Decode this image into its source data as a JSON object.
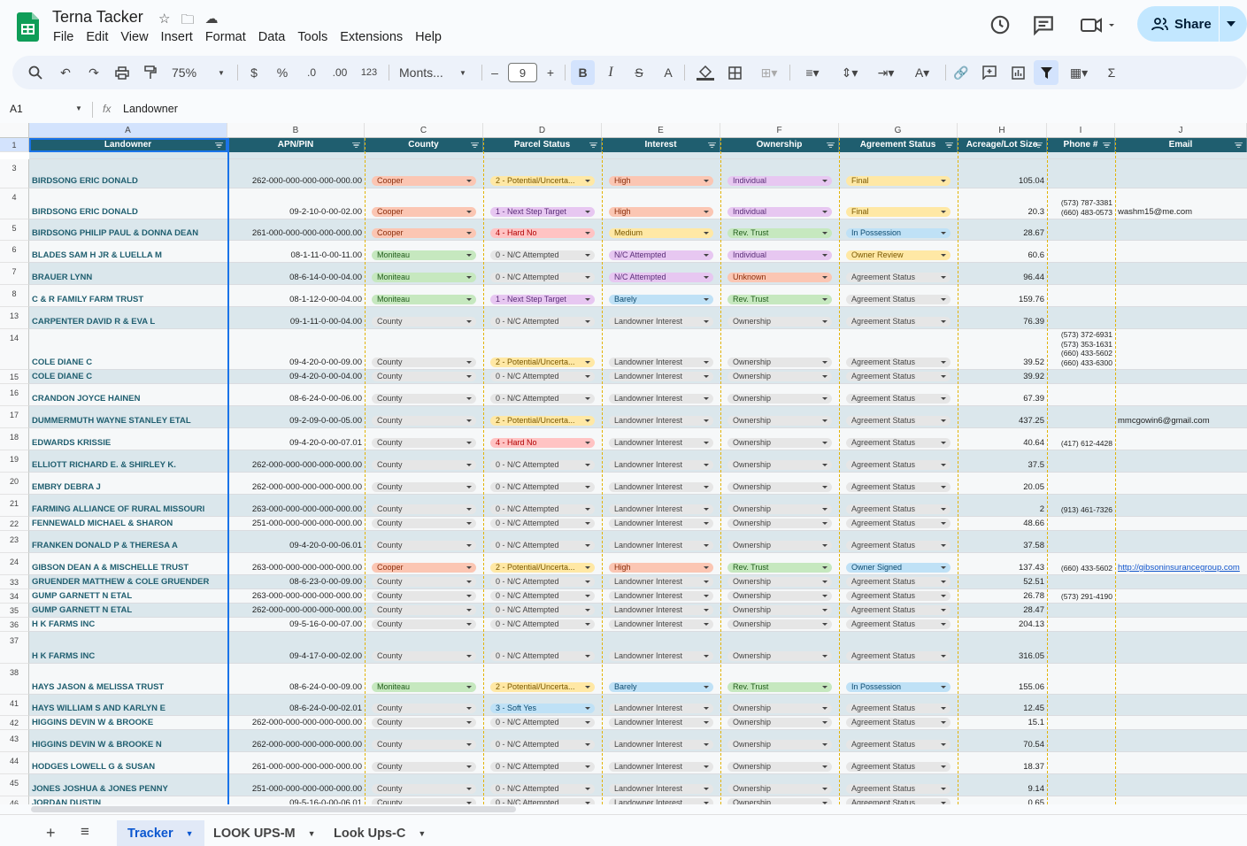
{
  "doc": {
    "title": "Terna Tacker"
  },
  "menu": [
    "File",
    "Edit",
    "View",
    "Insert",
    "Format",
    "Data",
    "Tools",
    "Extensions",
    "Help"
  ],
  "share": {
    "label": "Share"
  },
  "toolbar": {
    "zoom": "75%",
    "currency": "$",
    "percent": "%",
    "dec_less": ".0",
    "dec_more": ".00",
    "number_format": "123",
    "font": "Monts...",
    "font_size": "9",
    "bold": "B",
    "italic": "I",
    "strike": "S",
    "textcolor": "A"
  },
  "formula": {
    "cell_ref": "A1",
    "fx": "fx",
    "value": "Landowner"
  },
  "columns": [
    "A",
    "B",
    "C",
    "D",
    "E",
    "F",
    "G",
    "H",
    "I",
    "J"
  ],
  "headers": [
    "Landowner",
    "APN/PIN",
    "County",
    "Parcel Status",
    "Interest",
    "Ownership",
    "Agreement Status",
    "Acreage/Lot Size",
    "Phone #",
    "Email"
  ],
  "colors": {
    "header_bg": "#1f5e6f",
    "row_alt": "#dbe7ec",
    "accent": "#0b57d0",
    "share_bg": "#c2e7ff"
  },
  "rows": [
    {
      "n": "3",
      "h": 33,
      "alt": true,
      "owner": "BIRDSONG ERIC DONALD",
      "apn": "262-000-000-000-000-000.00",
      "county": "Cooper",
      "parcel": "2 - Potential/Uncerta...",
      "interest": "High",
      "ownership": "Individual",
      "agreement": "Final",
      "acreage": "105.04",
      "phone": "",
      "email": ""
    },
    {
      "n": "4",
      "h": 35,
      "alt": false,
      "owner": "BIRDSONG ERIC DONALD",
      "apn": "09-2-10-0-00-02.00",
      "county": "Cooper",
      "parcel": "1 - Next Step Target",
      "interest": "High",
      "ownership": "Individual",
      "agreement": "Final",
      "acreage": "20.3",
      "phone": "(573) 787-3381\n(660) 483-0573",
      "email": "washm15@me.com"
    },
    {
      "n": "5",
      "h": 24,
      "alt": true,
      "owner": "BIRDSONG PHILIP PAUL & DONNA DEAN",
      "apn": "261-000-000-000-000-000.00",
      "county": "Cooper",
      "parcel": "4 - Hard No",
      "interest": "Medium",
      "ownership": "Rev. Trust",
      "agreement": "In Possession",
      "acreage": "28.67",
      "phone": "",
      "email": ""
    },
    {
      "n": "6",
      "h": 25,
      "alt": false,
      "owner": "BLADES SAM H JR & LUELLA M",
      "apn": "08-1-11-0-00-11.00",
      "county": "Moniteau",
      "parcel": "0 - N/C Attempted",
      "interest": "N/C Attempted",
      "ownership": "Individual",
      "agreement": "Owner Review",
      "acreage": "60.6",
      "phone": "",
      "email": ""
    },
    {
      "n": "7",
      "h": 25,
      "alt": true,
      "owner": "BRAUER LYNN",
      "apn": "08-6-14-0-00-04.00",
      "county": "Moniteau",
      "parcel": "0 - N/C Attempted",
      "interest": "N/C Attempted",
      "ownership": "Unknown",
      "agreement": "Agreement Status",
      "acreage": "96.44",
      "phone": "",
      "email": ""
    },
    {
      "n": "8",
      "h": 25,
      "alt": false,
      "owner": "C & R FAMILY FARM TRUST",
      "apn": "08-1-12-0-00-04.00",
      "county": "Moniteau",
      "parcel": "1 - Next Step Target",
      "interest": "Barely",
      "ownership": "Rev. Trust",
      "agreement": "Agreement Status",
      "acreage": "159.76",
      "phone": "",
      "email": ""
    },
    {
      "n": "13",
      "h": 25,
      "alt": true,
      "owner": "CARPENTER DAVID R & EVA L",
      "apn": "09-1-11-0-00-04.00",
      "county": "County",
      "parcel": "0 - N/C Attempted",
      "interest": "Landowner Interest",
      "ownership": "Ownership",
      "agreement": "Agreement Status",
      "acreage": "76.39",
      "phone": "",
      "email": ""
    },
    {
      "n": "14",
      "h": 46,
      "alt": false,
      "owner": "COLE DIANE C",
      "apn": "09-4-20-0-00-09.00",
      "county": "County",
      "parcel": "2 - Potential/Uncerta...",
      "interest": "Landowner Interest",
      "ownership": "Ownership",
      "agreement": "Agreement Status",
      "acreage": "39.52",
      "phone": "(573) 372-6931\n(573) 353-1631\n(660) 433-5602\n(660) 433-6300",
      "email": ""
    },
    {
      "n": "15",
      "h": 16,
      "alt": true,
      "owner": "COLE DIANE C",
      "apn": "09-4-20-0-00-04.00",
      "county": "County",
      "parcel": "0 - N/C Attempted",
      "interest": "Landowner Interest",
      "ownership": "Ownership",
      "agreement": "Agreement Status",
      "acreage": "39.92",
      "phone": "",
      "email": ""
    },
    {
      "n": "16",
      "h": 25,
      "alt": false,
      "owner": "CRANDON JOYCE HAINEN",
      "apn": "08-6-24-0-00-06.00",
      "county": "County",
      "parcel": "0 - N/C Attempted",
      "interest": "Landowner Interest",
      "ownership": "Ownership",
      "agreement": "Agreement Status",
      "acreage": "67.39",
      "phone": "",
      "email": ""
    },
    {
      "n": "17",
      "h": 25,
      "alt": true,
      "owner": "DUMMERMUTH WAYNE STANLEY ETAL",
      "apn": "09-2-09-0-00-05.00",
      "county": "County",
      "parcel": "2 - Potential/Uncerta...",
      "interest": "Landowner Interest",
      "ownership": "Ownership",
      "agreement": "Agreement Status",
      "acreage": "437.25",
      "phone": "",
      "email": "mmcgowin6@gmail.com"
    },
    {
      "n": "18",
      "h": 25,
      "alt": false,
      "owner": "EDWARDS KRISSIE",
      "apn": "09-4-20-0-00-07.01",
      "county": "County",
      "parcel": "4 - Hard No",
      "interest": "Landowner Interest",
      "ownership": "Ownership",
      "agreement": "Agreement Status",
      "acreage": "40.64",
      "phone": "(417) 612-4428",
      "email": ""
    },
    {
      "n": "19",
      "h": 25,
      "alt": true,
      "owner": "ELLIOTT RICHARD E. & SHIRLEY K.",
      "apn": "262-000-000-000-000-000.00",
      "county": "County",
      "parcel": "0 - N/C Attempted",
      "interest": "Landowner Interest",
      "ownership": "Ownership",
      "agreement": "Agreement Status",
      "acreage": "37.5",
      "phone": "",
      "email": ""
    },
    {
      "n": "20",
      "h": 25,
      "alt": false,
      "owner": "EMBRY DEBRA J",
      "apn": "262-000-000-000-000-000.00",
      "county": "County",
      "parcel": "0 - N/C Attempted",
      "interest": "Landowner Interest",
      "ownership": "Ownership",
      "agreement": "Agreement Status",
      "acreage": "20.05",
      "phone": "",
      "email": ""
    },
    {
      "n": "21",
      "h": 25,
      "alt": true,
      "owner": "FARMING ALLIANCE OF RURAL MISSOURI",
      "apn": "263-000-000-000-000-000.00",
      "county": "County",
      "parcel": "0 - N/C Attempted",
      "interest": "Landowner Interest",
      "ownership": "Ownership",
      "agreement": "Agreement Status",
      "acreage": "2",
      "phone": "(913) 461-7326",
      "email": ""
    },
    {
      "n": "22",
      "h": 16,
      "alt": false,
      "owner": "FENNEWALD MICHAEL & SHARON",
      "apn": "251-000-000-000-000-000.00",
      "county": "County",
      "parcel": "0 - N/C Attempted",
      "interest": "Landowner Interest",
      "ownership": "Ownership",
      "agreement": "Agreement Status",
      "acreage": "48.66",
      "phone": "",
      "email": ""
    },
    {
      "n": "23",
      "h": 25,
      "alt": true,
      "owner": "FRANKEN DONALD P & THERESA A",
      "apn": "09-4-20-0-00-06.01",
      "county": "County",
      "parcel": "0 - N/C Attempted",
      "interest": "Landowner Interest",
      "ownership": "Ownership",
      "agreement": "Agreement Status",
      "acreage": "37.58",
      "phone": "",
      "email": ""
    },
    {
      "n": "24",
      "h": 25,
      "alt": false,
      "owner": "GIBSON DEAN A & MISCHELLE TRUST",
      "apn": "263-000-000-000-000-000.00",
      "county": "Cooper",
      "parcel": "2 - Potential/Uncerta...",
      "interest": "High",
      "ownership": "Rev. Trust",
      "agreement": "Owner Signed",
      "acreage": "137.43",
      "phone": "(660) 433-5602",
      "email": "http://gibsoninsurancegroup.com"
    },
    {
      "n": "33",
      "h": 16,
      "alt": true,
      "owner": "GRUENDER MATTHEW & COLE GRUENDER",
      "apn": "08-6-23-0-00-09.00",
      "county": "County",
      "parcel": "0 - N/C Attempted",
      "interest": "Landowner Interest",
      "ownership": "Ownership",
      "agreement": "Agreement Status",
      "acreage": "52.51",
      "phone": "",
      "email": ""
    },
    {
      "n": "34",
      "h": 16,
      "alt": false,
      "owner": "GUMP GARNETT N ETAL",
      "apn": "263-000-000-000-000-000.00",
      "county": "County",
      "parcel": "0 - N/C Attempted",
      "interest": "Landowner Interest",
      "ownership": "Ownership",
      "agreement": "Agreement Status",
      "acreage": "26.78",
      "phone": "(573) 291-4190",
      "email": ""
    },
    {
      "n": "35",
      "h": 16,
      "alt": true,
      "owner": "GUMP GARNETT N ETAL",
      "apn": "262-000-000-000-000-000.00",
      "county": "County",
      "parcel": "0 - N/C Attempted",
      "interest": "Landowner Interest",
      "ownership": "Ownership",
      "agreement": "Agreement Status",
      "acreage": "28.47",
      "phone": "",
      "email": ""
    },
    {
      "n": "36",
      "h": 16,
      "alt": false,
      "owner": "H K FARMS INC",
      "apn": "09-5-16-0-00-07.00",
      "county": "County",
      "parcel": "0 - N/C Attempted",
      "interest": "Landowner Interest",
      "ownership": "Ownership",
      "agreement": "Agreement Status",
      "acreage": "204.13",
      "phone": "",
      "email": ""
    },
    {
      "n": "37",
      "h": 36,
      "alt": true,
      "owner": "H K FARMS INC",
      "apn": "09-4-17-0-00-02.00",
      "county": "County",
      "parcel": "0 - N/C Attempted",
      "interest": "Landowner Interest",
      "ownership": "Ownership",
      "agreement": "Agreement Status",
      "acreage": "316.05",
      "phone": "",
      "email": ""
    },
    {
      "n": "38",
      "h": 35,
      "alt": false,
      "owner": "HAYS JASON & MELISSA TRUST",
      "apn": "08-6-24-0-00-09.00",
      "county": "Moniteau",
      "parcel": "2 - Potential/Uncerta...",
      "interest": "Barely",
      "ownership": "Rev. Trust",
      "agreement": "In Possession",
      "acreage": "155.06",
      "phone": "",
      "email": ""
    },
    {
      "n": "41",
      "h": 24,
      "alt": true,
      "owner": "HAYS WILLIAM S AND KARLYN E",
      "apn": "08-6-24-0-00-02.01",
      "county": "County",
      "parcel": "3 - Soft Yes",
      "interest": "Landowner Interest",
      "ownership": "Ownership",
      "agreement": "Agreement Status",
      "acreage": "12.45",
      "phone": "",
      "email": ""
    },
    {
      "n": "42",
      "h": 16,
      "alt": false,
      "owner": "HIGGINS DEVIN W & BROOKE",
      "apn": "262-000-000-000-000-000.00",
      "county": "County",
      "parcel": "0 - N/C Attempted",
      "interest": "Landowner Interest",
      "ownership": "Ownership",
      "agreement": "Agreement Status",
      "acreage": "15.1",
      "phone": "",
      "email": ""
    },
    {
      "n": "43",
      "h": 25,
      "alt": true,
      "owner": "HIGGINS DEVIN W & BROOKE N",
      "apn": "262-000-000-000-000-000.00",
      "county": "County",
      "parcel": "0 - N/C Attempted",
      "interest": "Landowner Interest",
      "ownership": "Ownership",
      "agreement": "Agreement Status",
      "acreage": "70.54",
      "phone": "",
      "email": ""
    },
    {
      "n": "44",
      "h": 25,
      "alt": false,
      "owner": "HODGES LOWELL G & SUSAN",
      "apn": "261-000-000-000-000-000.00",
      "county": "County",
      "parcel": "0 - N/C Attempted",
      "interest": "Landowner Interest",
      "ownership": "Ownership",
      "agreement": "Agreement Status",
      "acreage": "18.37",
      "phone": "",
      "email": ""
    },
    {
      "n": "45",
      "h": 25,
      "alt": true,
      "owner": "JONES JOSHUA & JONES PENNY",
      "apn": "251-000-000-000-000-000.00",
      "county": "County",
      "parcel": "0 - N/C Attempted",
      "interest": "Landowner Interest",
      "ownership": "Ownership",
      "agreement": "Agreement Status",
      "acreage": "9.14",
      "phone": "",
      "email": ""
    },
    {
      "n": "46",
      "h": 16,
      "alt": false,
      "owner": "JORDAN DUSTIN",
      "apn": "09-5-16-0-00-06.01",
      "county": "County",
      "parcel": "0 - N/C Attempted",
      "interest": "Landowner Interest",
      "ownership": "Ownership",
      "agreement": "Agreement Status",
      "acreage": "0.65",
      "phone": "",
      "email": ""
    }
  ],
  "tabs": [
    {
      "label": "Tracker",
      "active": true
    },
    {
      "label": "LOOK UPS-M",
      "active": false
    },
    {
      "label": "Look Ups-C",
      "active": false
    }
  ]
}
